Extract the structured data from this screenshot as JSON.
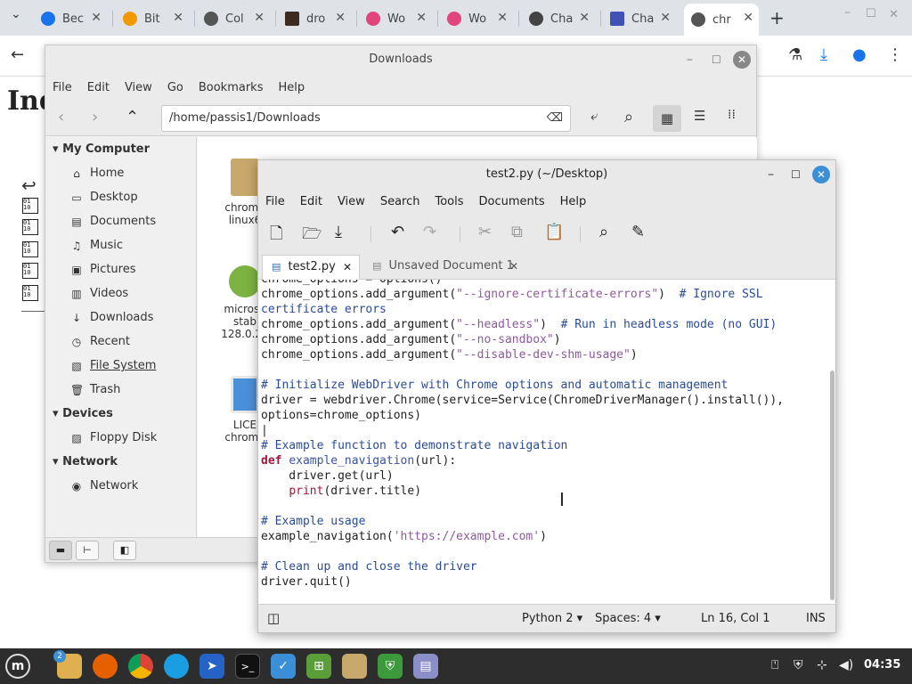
{
  "browser": {
    "tabs": [
      {
        "title": "Bec",
        "fav_color": "#1a73e8"
      },
      {
        "title": "Bit",
        "fav_color": "#f29900"
      },
      {
        "title": "Col",
        "fav_color": "#555555"
      },
      {
        "title": "dro",
        "fav_color": "#3d2b1f"
      },
      {
        "title": "Wo",
        "fav_color": "#e0457b"
      },
      {
        "title": "Wo",
        "fav_color": "#e0457b"
      },
      {
        "title": "Cha",
        "fav_color": "#444444"
      },
      {
        "title": "Cha",
        "fav_color": "#3f51b5"
      },
      {
        "title": "chr",
        "fav_color": "#555555"
      }
    ],
    "new_tab": "+",
    "page_heading": "Ind"
  },
  "nemo": {
    "title": "Downloads",
    "menu": [
      "File",
      "Edit",
      "View",
      "Go",
      "Bookmarks",
      "Help"
    ],
    "path": "/home/passis1/Downloads",
    "sidebar": {
      "my_computer": "My Computer",
      "items": [
        "Home",
        "Desktop",
        "Documents",
        "Music",
        "Pictures",
        "Videos",
        "Downloads",
        "Recent",
        "File System",
        "Trash"
      ],
      "devices": "Devices",
      "device_items": [
        "Floppy Disk"
      ],
      "network": "Network",
      "network_items": [
        "Network"
      ]
    },
    "files": [
      {
        "line1": "chrome",
        "line2": "linux6"
      },
      {
        "line1": "microso",
        "line2": "stab",
        "line3": "128.0.27"
      },
      {
        "line1": "LICE",
        "line2": "chrome"
      }
    ]
  },
  "xed": {
    "title": "test2.py (~/Desktop)",
    "menu": [
      "File",
      "Edit",
      "View",
      "Search",
      "Tools",
      "Documents",
      "Help"
    ],
    "tabs": [
      "test2.py",
      "Unsaved Document 1"
    ],
    "status": {
      "language": "Python 2",
      "spaces": "Spaces: 4",
      "position": "Ln 16, Col 1",
      "mode": "INS"
    }
  },
  "taskbar": {
    "badge": "2",
    "clock": "04:35"
  }
}
